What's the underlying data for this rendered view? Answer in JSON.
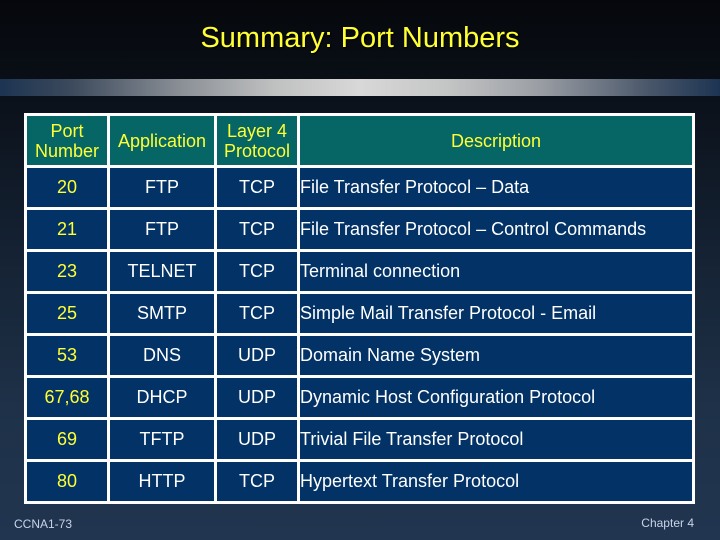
{
  "slide": {
    "title": "Summary: Port Numbers",
    "footer_left": "CCNA1-73",
    "footer_right": "Chapter 4"
  },
  "colors": {
    "title": "#ffff33",
    "header_bg": "#066666",
    "row_bg": "#033366",
    "port_text": "#ffff33",
    "cell_text": "#ffffff",
    "grid_lines": "#ffffff"
  },
  "table": {
    "headers": {
      "port_line1": "Port",
      "port_line2": "Number",
      "application": "Application",
      "layer4_line1": "Layer 4",
      "layer4_line2": "Protocol",
      "description": "Description"
    },
    "rows": [
      {
        "port": "20",
        "application": "FTP",
        "protocol": "TCP",
        "description": "File Transfer Protocol – Data"
      },
      {
        "port": "21",
        "application": "FTP",
        "protocol": "TCP",
        "description": "File Transfer Protocol – Control Commands"
      },
      {
        "port": "23",
        "application": "TELNET",
        "protocol": "TCP",
        "description": "Terminal connection"
      },
      {
        "port": "25",
        "application": "SMTP",
        "protocol": "TCP",
        "description": "Simple Mail Transfer Protocol - Email"
      },
      {
        "port": "53",
        "application": "DNS",
        "protocol": "UDP",
        "description": "Domain Name System"
      },
      {
        "port": "67,68",
        "application": "DHCP",
        "protocol": "UDP",
        "description": "Dynamic Host Configuration Protocol"
      },
      {
        "port": "69",
        "application": "TFTP",
        "protocol": "UDP",
        "description": "Trivial File Transfer Protocol"
      },
      {
        "port": "80",
        "application": "HTTP",
        "protocol": "TCP",
        "description": "Hypertext Transfer Protocol"
      }
    ]
  }
}
